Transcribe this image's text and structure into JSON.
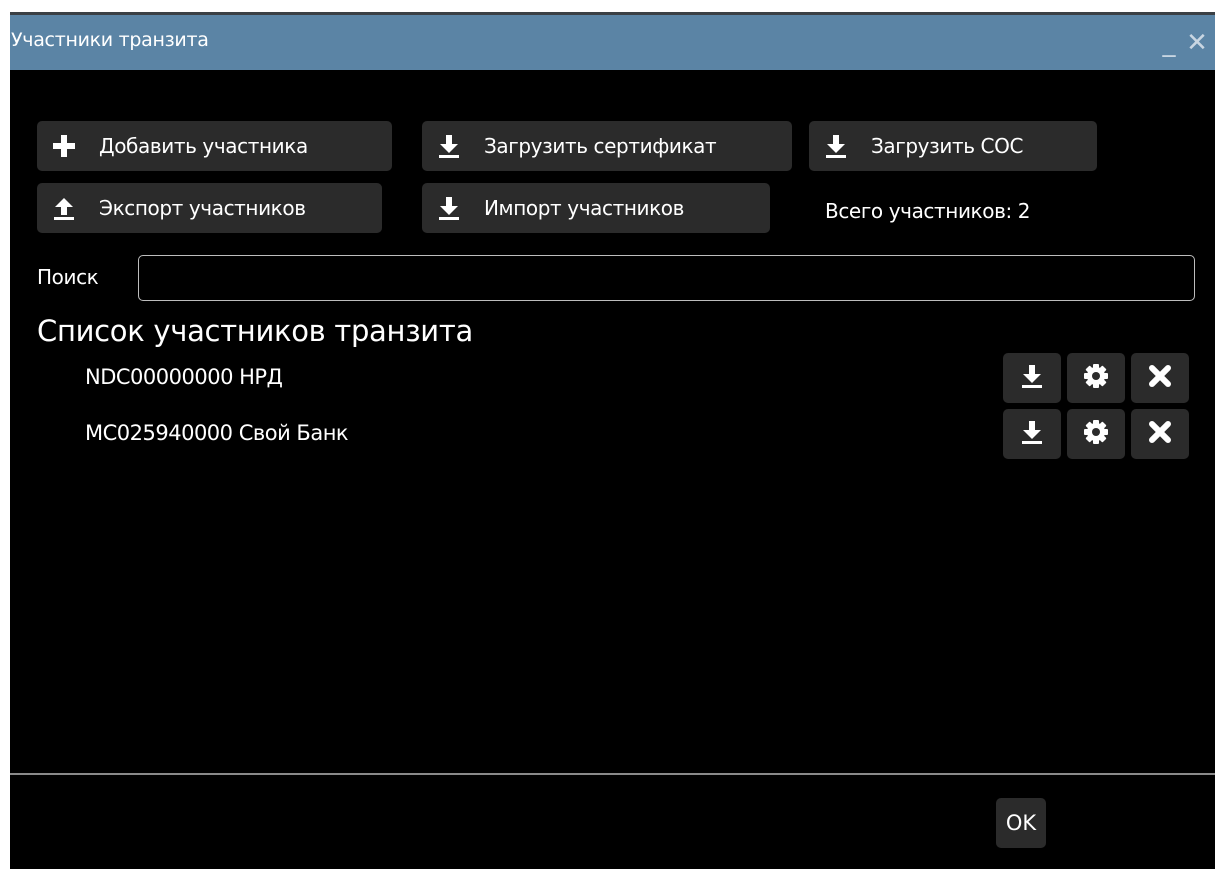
{
  "window": {
    "title": "Участники транзита",
    "minimize_glyph": "_",
    "close_glyph": "✕"
  },
  "toolbar": {
    "add_participant": "Добавить участника",
    "upload_certificate": "Загрузить сертификат",
    "upload_crl": "Загрузить СОС",
    "export_participants": "Экспорт участников",
    "import_participants": "Импорт участников",
    "total_participants": "Всего участников: 2"
  },
  "search": {
    "label": "Поиск",
    "value": ""
  },
  "list": {
    "heading": "Список участников транзита",
    "items": [
      {
        "name": "NDC00000000 НРД"
      },
      {
        "name": "MC025940000 Свой Банк"
      }
    ]
  },
  "footer": {
    "ok_label": "OK"
  },
  "icons": {
    "add": "plus-icon",
    "download": "download-icon",
    "upload": "upload-icon",
    "settings": "gear-icon",
    "delete": "close-icon"
  },
  "colors": {
    "titlebar": "#5b84a5",
    "window_bg": "#000000",
    "button_bg": "#2b2b2b",
    "text": "#ffffff"
  }
}
